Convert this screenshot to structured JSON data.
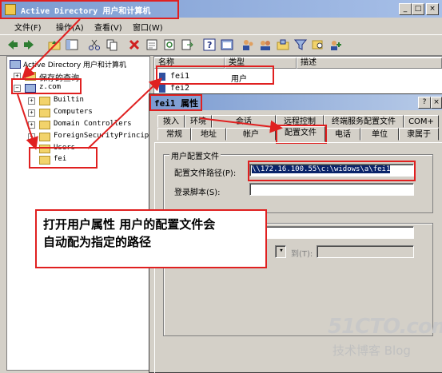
{
  "window": {
    "title": "Active Directory 用户和计算机"
  },
  "menu": [
    {
      "label": "文件(F)"
    },
    {
      "label": "操作(A)"
    },
    {
      "label": "查看(V)"
    },
    {
      "label": "窗口(W)"
    }
  ],
  "tree": {
    "root": "Active Directory 用户和计算机",
    "saved_queries": "保存的查询",
    "domain": "z.com",
    "children": [
      "Builtin",
      "Computers",
      "Domain Controllers",
      "ForeignSecurityPrincip",
      "Users",
      "fei"
    ]
  },
  "list": {
    "columns": [
      "名称",
      "类型",
      "描述"
    ],
    "rows": [
      {
        "name": "fei1",
        "type": "用户"
      },
      {
        "name": "fei2",
        "type": ""
      }
    ]
  },
  "dialog": {
    "title": "fei1 属性",
    "tabs_row1": [
      "拨入",
      "环境",
      "会话",
      "远程控制",
      "终端服务配置文件",
      "COM+"
    ],
    "tabs_row2": [
      "常规",
      "地址",
      "帐户",
      "配置文件",
      "电话",
      "单位",
      "隶属于"
    ],
    "active_tab": "配置文件",
    "group_title": "用户配置文件",
    "profile_path_label": "配置文件路径(P):",
    "profile_path_value": "\\\\172.16.100.55\\c:\\widows\\a\\fei1",
    "logon_script_label": "登录脚本(S):",
    "to_label": "到(T):"
  },
  "callout": {
    "line1": "打开用户属性 用户的配置文件会",
    "line2": "自动配为指定的路径"
  },
  "watermark": {
    "brand": "51CTO.com",
    "sub": "技术博客 Blog"
  },
  "colors": {
    "annotation": "#e02020",
    "title_bar": "#7b9bd1",
    "selection": "#0a246a"
  }
}
